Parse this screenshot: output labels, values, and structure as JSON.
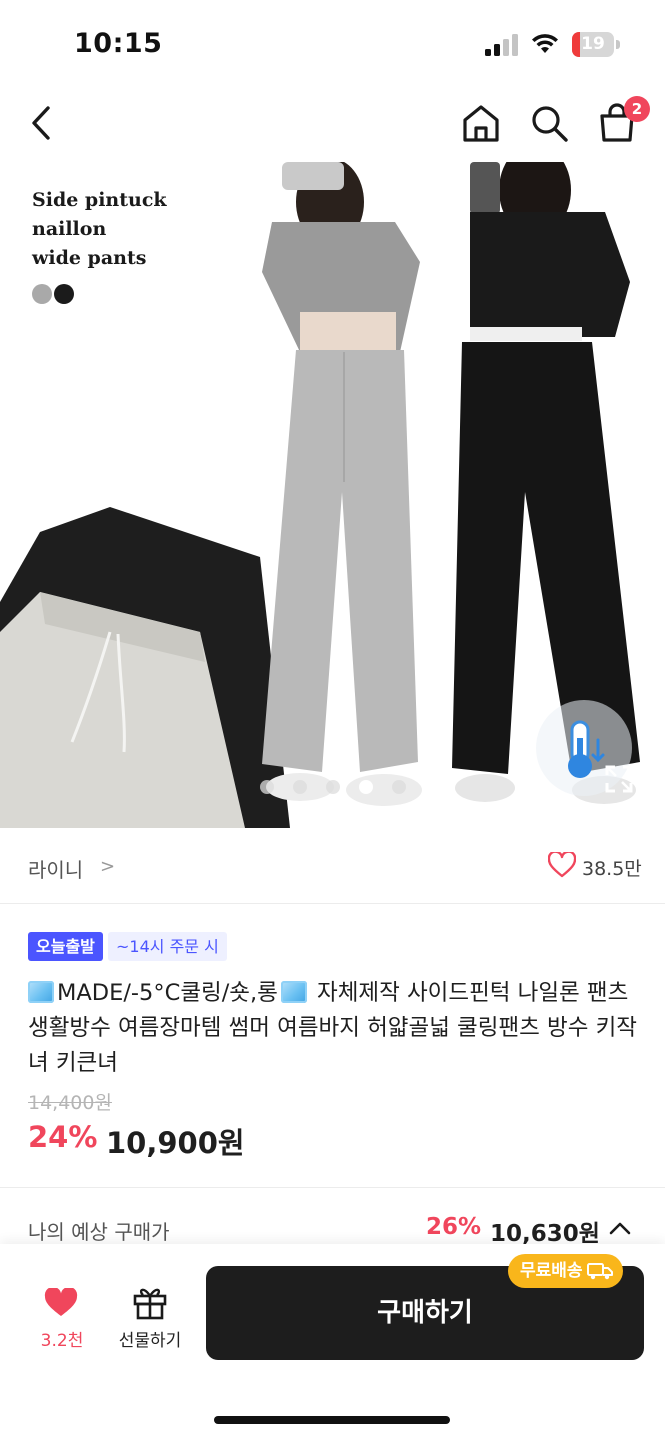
{
  "status_bar": {
    "time": "10:15",
    "battery": "19",
    "battery_level": 0.19,
    "battery_color": "#ef3b3b"
  },
  "nav": {
    "icons": [
      "back-icon",
      "home-icon",
      "search-icon",
      "cart-icon"
    ],
    "cart_count": "2"
  },
  "product_image": {
    "caption": "Side pintuck\nnaillon\nwide pants",
    "swatch_colors": [
      "#a9a9a9",
      "#1b1b1b"
    ],
    "carousel": {
      "total": 5,
      "active_index": 3
    }
  },
  "brand": {
    "name": "라이니",
    "chevron": ">",
    "likes": "38.5만"
  },
  "badges": {
    "today_ship": "오늘출발",
    "cutoff": "~14시 주문 시"
  },
  "product": {
    "title_part1": "MADE/-5°C쿨링/숏,롱",
    "title_part2": " 자체제작 사이드핀턱 나일론 팬츠 생활방수 여름장마템 썸머 여름바지 허얇골넓 쿨링팬츠 방수 키작녀 키큰녀",
    "original_price": "14,400원",
    "discount_rate": "24%",
    "final_price": "10,900원"
  },
  "expected": {
    "label": "나의 예상 구매가",
    "rate": "26%",
    "price": "10,630원"
  },
  "bottom_bar": {
    "wish_count": "3.2천",
    "gift_label": "선물하기",
    "buy_label": "구매하기",
    "free_shipping": "무료배송"
  },
  "colors": {
    "accent_red": "#f0465c",
    "badge_blue": "#4b55ff",
    "shipping_yellow": "#f9b61b"
  }
}
